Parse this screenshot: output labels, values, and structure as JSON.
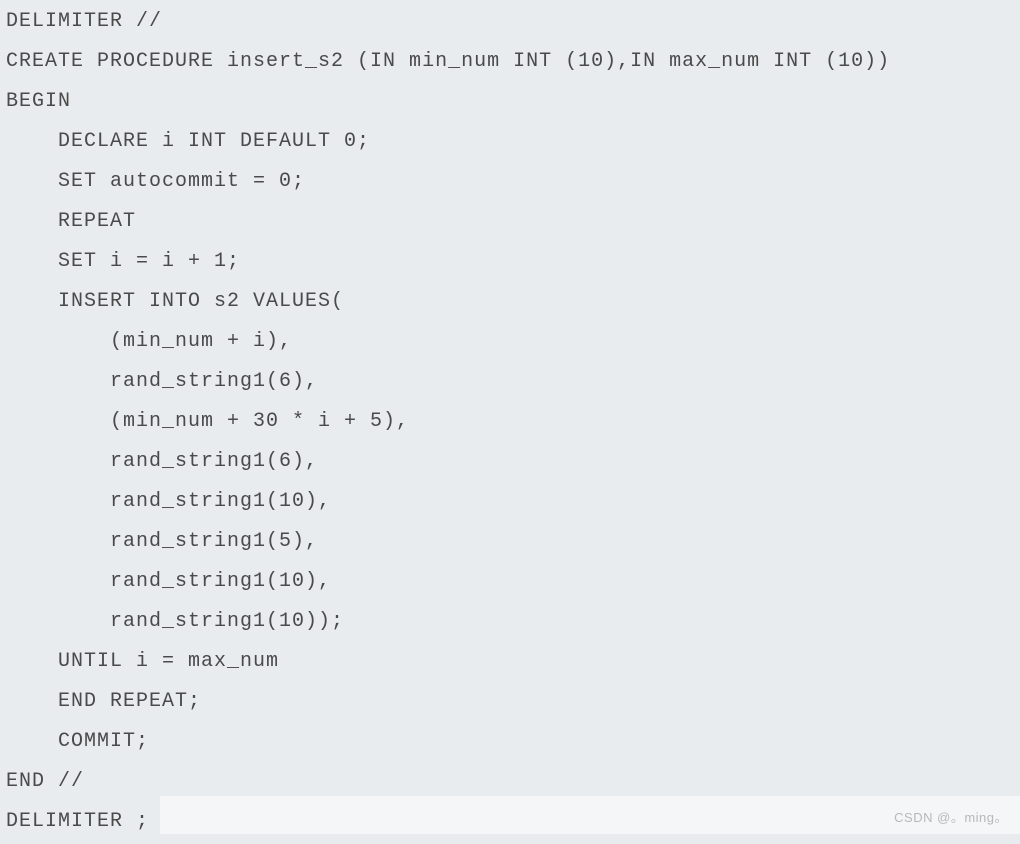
{
  "code": {
    "lines": [
      "DELIMITER //",
      "CREATE PROCEDURE insert_s2 (IN min_num INT (10),IN max_num INT (10))",
      "BEGIN",
      "    DECLARE i INT DEFAULT 0;",
      "    SET autocommit = 0;",
      "    REPEAT",
      "    SET i = i + 1;",
      "    INSERT INTO s2 VALUES(",
      "        (min_num + i),",
      "        rand_string1(6),",
      "        (min_num + 30 * i + 5),",
      "        rand_string1(6),",
      "        rand_string1(10),",
      "        rand_string1(5),",
      "        rand_string1(10),",
      "        rand_string1(10));",
      "    UNTIL i = max_num",
      "    END REPEAT;",
      "    COMMIT;",
      "END //",
      "DELIMITER ;"
    ]
  },
  "watermark": "CSDN @。ming。"
}
